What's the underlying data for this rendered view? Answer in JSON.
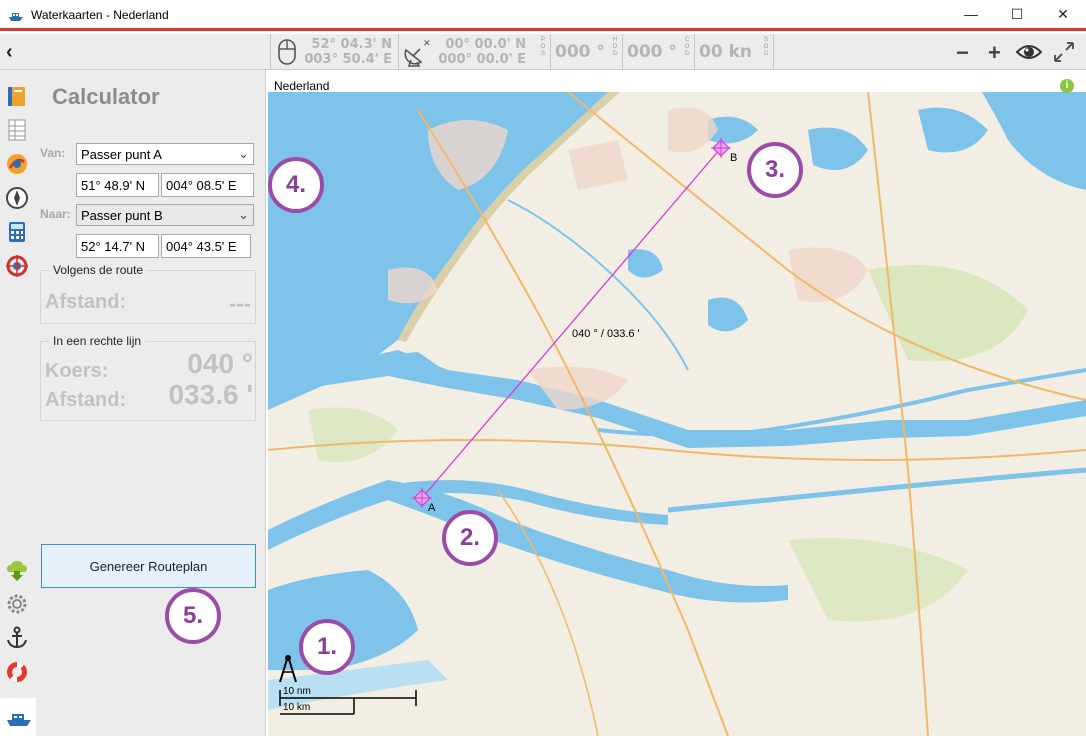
{
  "window": {
    "title": "Waterkaarten - Nederland",
    "controls": {
      "minimize": "—",
      "maximize": "☐",
      "close": "✕"
    }
  },
  "toolbar": {
    "back": "‹",
    "cursor_lat": "52° 04.3' N",
    "cursor_lon": "003° 50.4' E",
    "gps_lat": "00° 00.0' N",
    "gps_lon": "000° 00.0' E",
    "pos_label": [
      "P",
      "O",
      "S"
    ],
    "hdg_value": "000 °",
    "hdg_label": [
      "H",
      "D",
      "G"
    ],
    "cog_value": "000 °",
    "cog_label": [
      "C",
      "O",
      "G"
    ],
    "sog_value": "00 kn",
    "sog_label": [
      "S",
      "O",
      "G"
    ],
    "zoom_out": "−",
    "zoom_in": "+",
    "icons": [
      "mouse-icon",
      "satellite-dish-icon",
      "zoom-out-icon",
      "zoom-in-icon",
      "eye-icon",
      "fullscreen-icon"
    ]
  },
  "sidebar": {
    "icons": [
      "book-icon",
      "logbook-icon",
      "route-icon",
      "compass-icon",
      "calculator-icon",
      "target-icon"
    ],
    "bottom_icons": [
      "cloud-download-icon",
      "gear-icon",
      "anchor-icon",
      "lifebuoy-icon",
      "boat-icon",
      "facebook-icon",
      "mail-icon"
    ]
  },
  "calculator": {
    "title": "Calculator",
    "from_label": "Van:",
    "from_value": "Passer punt A",
    "from_lat": "51° 48.9' N",
    "from_lon": "004° 08.5' E",
    "to_label": "Naar:",
    "to_value": "Passer punt B",
    "to_lat": "52° 14.7' N",
    "to_lon": "004° 43.5' E",
    "route_group": "Volgens de route",
    "route_distance_label": "Afstand:",
    "route_distance_value": "---",
    "straight_group": "In een rechte lijn",
    "course_label": "Koers:",
    "course_value": "040 °",
    "straight_distance_label": "Afstand:",
    "straight_distance_value": "033.6 '",
    "generate_button": "Genereer Routeplan"
  },
  "map": {
    "title": "Nederland",
    "line_label": "040 ° / 033.6 '",
    "point_a": "A",
    "point_b": "B",
    "scale_nm": "10 nm",
    "scale_km": "10 km",
    "info_icon": "i",
    "colors": {
      "water": "#7ec3ea",
      "land": "#f3eee3",
      "route": "#d63ad6",
      "callout": "#9b4ca8"
    }
  },
  "callouts": [
    "1.",
    "2.",
    "3.",
    "4.",
    "5."
  ]
}
